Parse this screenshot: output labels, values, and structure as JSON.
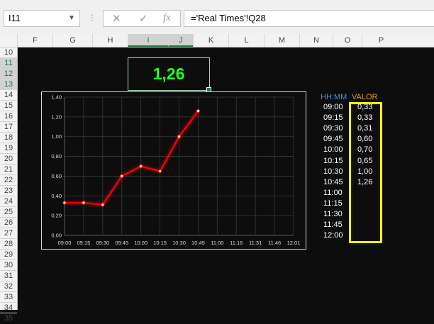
{
  "formula_bar": {
    "name_box": "I11",
    "cancel_icon": "✕",
    "enter_icon": "✓",
    "function_icon": "fx",
    "formula": "='Real Times'!Q28"
  },
  "columns": [
    "F",
    "G",
    "H",
    "I",
    "J",
    "K",
    "L",
    "M",
    "N",
    "O",
    "P"
  ],
  "rows": [
    "10",
    "11",
    "12",
    "13",
    "14",
    "15",
    "16",
    "17",
    "18",
    "19",
    "20",
    "21",
    "22",
    "23",
    "24",
    "25",
    "26",
    "27",
    "28",
    "29",
    "30",
    "31",
    "32",
    "33",
    "34",
    "35"
  ],
  "selected_cell_value": "1,26",
  "table": {
    "time_header": "HH:MM",
    "value_header": "VALOR",
    "times": [
      "09:00",
      "09:15",
      "09:30",
      "09:45",
      "10:00",
      "10:15",
      "10:30",
      "10:45",
      "11:00",
      "11:15",
      "11:30",
      "11:45",
      "12:00"
    ],
    "values": [
      "0,33",
      "0,33",
      "0,31",
      "0,60",
      "0,70",
      "0,65",
      "1,00",
      "1,26",
      "",
      "",
      "",
      "",
      ""
    ]
  },
  "chart_data": {
    "type": "line",
    "categories": [
      "09:00",
      "09:15",
      "09:30",
      "09:45",
      "10:00",
      "10:15",
      "10:30",
      "10:45",
      "11:00",
      "11:16",
      "11:31",
      "11:46",
      "12:01"
    ],
    "values": [
      0.33,
      0.33,
      0.31,
      0.6,
      0.7,
      0.65,
      1.0,
      1.26
    ],
    "y_ticks": [
      "0,00",
      "0,20",
      "0,40",
      "0,60",
      "0,80",
      "1,00",
      "1,20",
      "1,40"
    ],
    "ylim": [
      0,
      1.4
    ],
    "grid": true,
    "line_color": "#ff0000",
    "background": "#0d0d0d"
  },
  "colors": {
    "accent_green": "#22ff22",
    "highlight_yellow": "#ffff00",
    "time_header_blue": "#3a96e0",
    "value_header_orange": "#d89c28"
  }
}
